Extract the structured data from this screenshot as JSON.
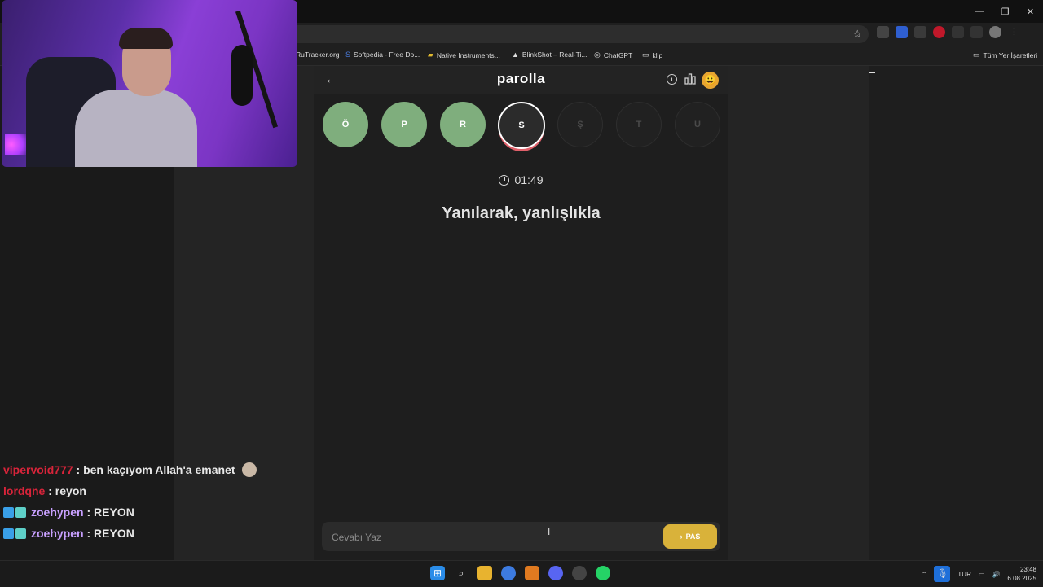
{
  "browser": {
    "window_controls": [
      "—",
      "❐",
      "✕"
    ],
    "bookmarks": [
      {
        "label": "RuTracker.org",
        "icon": ""
      },
      {
        "label": "Softpedia - Free Do...",
        "icon": "S"
      },
      {
        "label": "Native Instruments...",
        "icon": "▰"
      },
      {
        "label": "BlinkShot – Real-Ti...",
        "icon": "▲"
      },
      {
        "label": "ChatGPT",
        "icon": "◎"
      },
      {
        "label": "klip",
        "icon": "▭"
      }
    ],
    "all_bookmarks": "Tüm Yer İşaretleri"
  },
  "game": {
    "back": "←",
    "logo": "parolla",
    "info": "i",
    "avatar": "😀",
    "letters": [
      "Ö",
      "P",
      "R",
      "S",
      "Ş",
      "T",
      "U"
    ],
    "letter_states": [
      "done",
      "done",
      "done",
      "active",
      "pending",
      "pending",
      "pending"
    ],
    "timer": "01:49",
    "question": "Yanılarak, yanlışlıkla",
    "answer_placeholder": "Cevabı Yaz",
    "pass_arrow": "›",
    "pass_label": "PAS"
  },
  "chat": [
    {
      "user": "vipervoid777",
      "color": "#d8243a",
      "sep": " : ",
      "msg": "ben kaçıyom Allah'a emanet",
      "badges": false,
      "emote": true
    },
    {
      "user": "lordqne",
      "color": "#d8243a",
      "sep": " : ",
      "msg": "reyon",
      "badges": false,
      "emote": false
    },
    {
      "user": "zoehypen",
      "color": "#c8a0ff",
      "sep": " : ",
      "msg": "REYON",
      "badges": true,
      "emote": false
    },
    {
      "user": "zoehypen",
      "color": "#c8a0ff",
      "sep": " : ",
      "msg": "REYON",
      "badges": true,
      "emote": false
    }
  ],
  "taskbar": {
    "language": "TUR",
    "time": "23:48",
    "date": "6.08.2025"
  },
  "colors": {
    "letter_done": "#7fae7d",
    "pass_button": "#d9b23a",
    "progress_ring": "#e0606a"
  }
}
